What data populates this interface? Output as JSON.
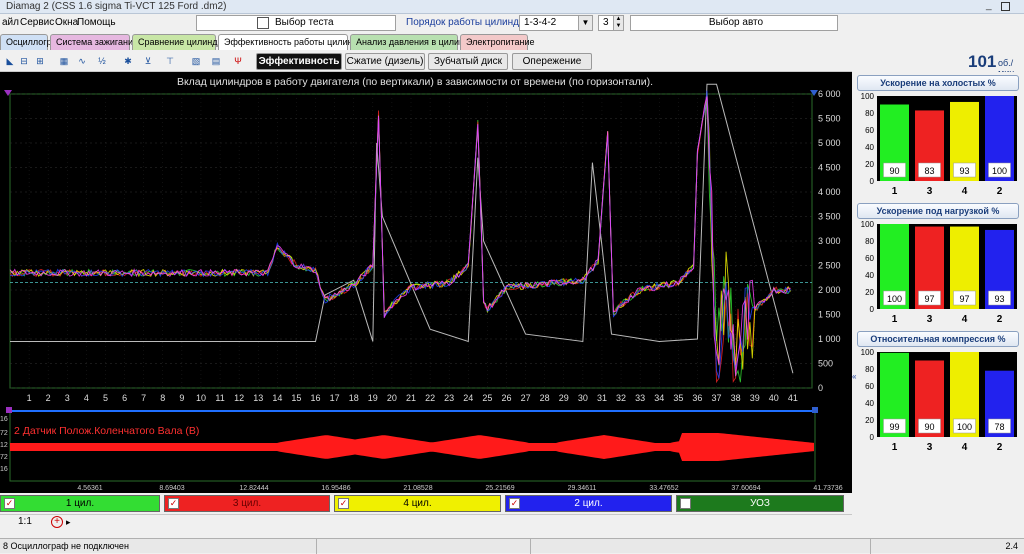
{
  "window": {
    "title": "Diamag 2 (CSS 1.6 sigma Ti-VCT 125 Ford .dm2)"
  },
  "menu": [
    {
      "label": "айл"
    },
    {
      "label": "Сервис"
    },
    {
      "label": "Окна"
    },
    {
      "label": "Помощь"
    }
  ],
  "controls": {
    "test_select": "Выбор теста",
    "cylinder_order_label": "Порядок работы цилиндров",
    "cylinder_order_value": "1-3-4-2",
    "cylinder_count": "3",
    "auto_select": "Выбор авто"
  },
  "tabs": [
    {
      "label": "Осциллограф",
      "color": "#cfe0f5"
    },
    {
      "label": "Система зажигания",
      "color": "#e6b8e0"
    },
    {
      "label": "Сравнение цилиндров",
      "color": "#c8e6a6"
    },
    {
      "label": "Эффективность работы цилиндров",
      "color": "#ffffff"
    },
    {
      "label": "Анализ давления в цилиндре",
      "color": "#b8e0b0"
    },
    {
      "label": "Электропитание",
      "color": "#f3c9c9"
    }
  ],
  "subtabs": [
    {
      "label": "Эффективность",
      "active": true
    },
    {
      "label": "Сжатие (дизель)",
      "active": false
    },
    {
      "label": "Зубчатый диск",
      "active": false
    },
    {
      "label": "Опережение",
      "active": false
    }
  ],
  "rpm": {
    "value": "101",
    "unit": "об./мин"
  },
  "chart_title": "Вклад цилиндров в работу двигателя (по вертикали) в зависимости от времени (по горизонтали).",
  "y_ticks": [
    "6 000",
    "5 500",
    "5 000",
    "4 500",
    "4 000",
    "3 500",
    "3 000",
    "2 500",
    "2 000",
    "1 500",
    "1 000",
    "500",
    "0"
  ],
  "x_ticks": [
    "1",
    "2",
    "3",
    "4",
    "5",
    "6",
    "7",
    "8",
    "9",
    "10",
    "11",
    "12",
    "13",
    "14",
    "15",
    "16",
    "17",
    "18",
    "19",
    "20",
    "21",
    "22",
    "23",
    "24",
    "25",
    "26",
    "27",
    "28",
    "29",
    "30",
    "31",
    "32",
    "33",
    "34",
    "35",
    "36",
    "37",
    "38",
    "39",
    "40",
    "41"
  ],
  "lower": {
    "label": "2 Датчик Полож.Коленчатого Вала (В)",
    "y_labels": [
      "16",
      "72",
      "12",
      "72",
      "16"
    ],
    "time_ticks": [
      "4.56361",
      "8.69403",
      "12.82444",
      "16.95486",
      "21.08528",
      "25.21569",
      "29.34611",
      "33.47652",
      "37.60694",
      "41.73736"
    ]
  },
  "cylinders": [
    {
      "label": "1 цил.",
      "color": "#33dd33",
      "checked": true
    },
    {
      "label": "3 цил.",
      "color": "#ee2222",
      "checked": true
    },
    {
      "label": "4 цил.",
      "color": "#f0f000",
      "checked": true
    },
    {
      "label": "2 цил.",
      "color": "#2222ee",
      "checked": true
    },
    {
      "label": "УОЗ",
      "color": "#1d7a1d",
      "checked": false
    }
  ],
  "scale_label": "1:1",
  "status": {
    "left": "8 Осциллограф не подключен",
    "right": "2.4"
  },
  "bar_charts": [
    {
      "title": "Ускорение на холостых %",
      "categories": [
        "1",
        "3",
        "4",
        "2"
      ],
      "values": [
        90,
        83,
        93,
        100
      ],
      "colors": [
        "#22ee22",
        "#ee2222",
        "#eeee00",
        "#2222ee"
      ],
      "y_ticks": [
        "100",
        "80",
        "60",
        "40",
        "20",
        "0"
      ]
    },
    {
      "title": "Ускорение под нагрузкой %",
      "categories": [
        "1",
        "3",
        "4",
        "2"
      ],
      "values": [
        100,
        97,
        97,
        93
      ],
      "colors": [
        "#22ee22",
        "#ee2222",
        "#eeee00",
        "#2222ee"
      ],
      "y_ticks": [
        "100",
        "80",
        "60",
        "40",
        "20",
        "0"
      ]
    },
    {
      "title": "Относительная компрессия %",
      "categories": [
        "1",
        "3",
        "4",
        "2"
      ],
      "values": [
        99,
        90,
        100,
        78
      ],
      "colors": [
        "#22ee22",
        "#ee2222",
        "#eeee00",
        "#2222ee"
      ],
      "y_ticks": [
        "100",
        "80",
        "60",
        "40",
        "20",
        "0"
      ]
    }
  ],
  "chart_data": [
    {
      "type": "bar",
      "title": "Ускорение на холостых %",
      "categories": [
        "1",
        "3",
        "4",
        "2"
      ],
      "values": [
        90,
        83,
        93,
        100
      ],
      "ylim": [
        0,
        100
      ]
    },
    {
      "type": "bar",
      "title": "Ускорение под нагрузкой %",
      "categories": [
        "1",
        "3",
        "4",
        "2"
      ],
      "values": [
        100,
        97,
        97,
        93
      ],
      "ylim": [
        0,
        100
      ]
    },
    {
      "type": "bar",
      "title": "Относительная компрессия %",
      "categories": [
        "1",
        "3",
        "4",
        "2"
      ],
      "values": [
        99,
        90,
        100,
        78
      ],
      "ylim": [
        0,
        100
      ]
    },
    {
      "type": "line",
      "title": "Вклад цилиндров в работу двигателя (по вертикали) в зависимости от времени (по горизонтали).",
      "xlim": [
        0,
        42
      ],
      "ylim": [
        0,
        6000
      ],
      "reference_level": 2150,
      "series": [
        {
          "x": [
            0,
            13.5,
            14,
            15,
            16,
            16.5,
            18,
            19,
            19.3,
            19.6,
            20,
            21,
            23,
            24,
            24.5,
            24.8,
            25,
            26,
            30,
            30.8,
            31.3,
            31.6,
            32,
            33,
            35,
            35.8,
            36,
            36.5,
            37,
            37.5,
            38,
            39,
            40,
            41
          ],
          "y": [
            2350,
            2350,
            2900,
            2500,
            2400,
            1800,
            2100,
            2500,
            5600,
            1500,
            1700,
            2050,
            2150,
            2500,
            5400,
            1800,
            1600,
            2050,
            2200,
            2600,
            5200,
            1500,
            1700,
            2000,
            2150,
            2500,
            4800,
            6000,
            500,
            2000,
            700,
            1600,
            2000,
            2000
          ]
        },
        {
          "x": [
            0,
            13.5,
            16,
            16.5,
            18,
            19,
            19.2,
            19.5,
            22,
            24,
            24.5,
            24.8,
            27,
            30,
            30.5,
            31,
            31.5,
            34,
            36,
            36.5,
            37,
            41
          ],
          "y": [
            950,
            950,
            950,
            1900,
            2200,
            950,
            5000,
            3500,
            1200,
            950,
            4700,
            3000,
            1100,
            950,
            4600,
            2900,
            1100,
            950,
            1000,
            6200,
            6200,
            300
          ]
        }
      ]
    }
  ]
}
